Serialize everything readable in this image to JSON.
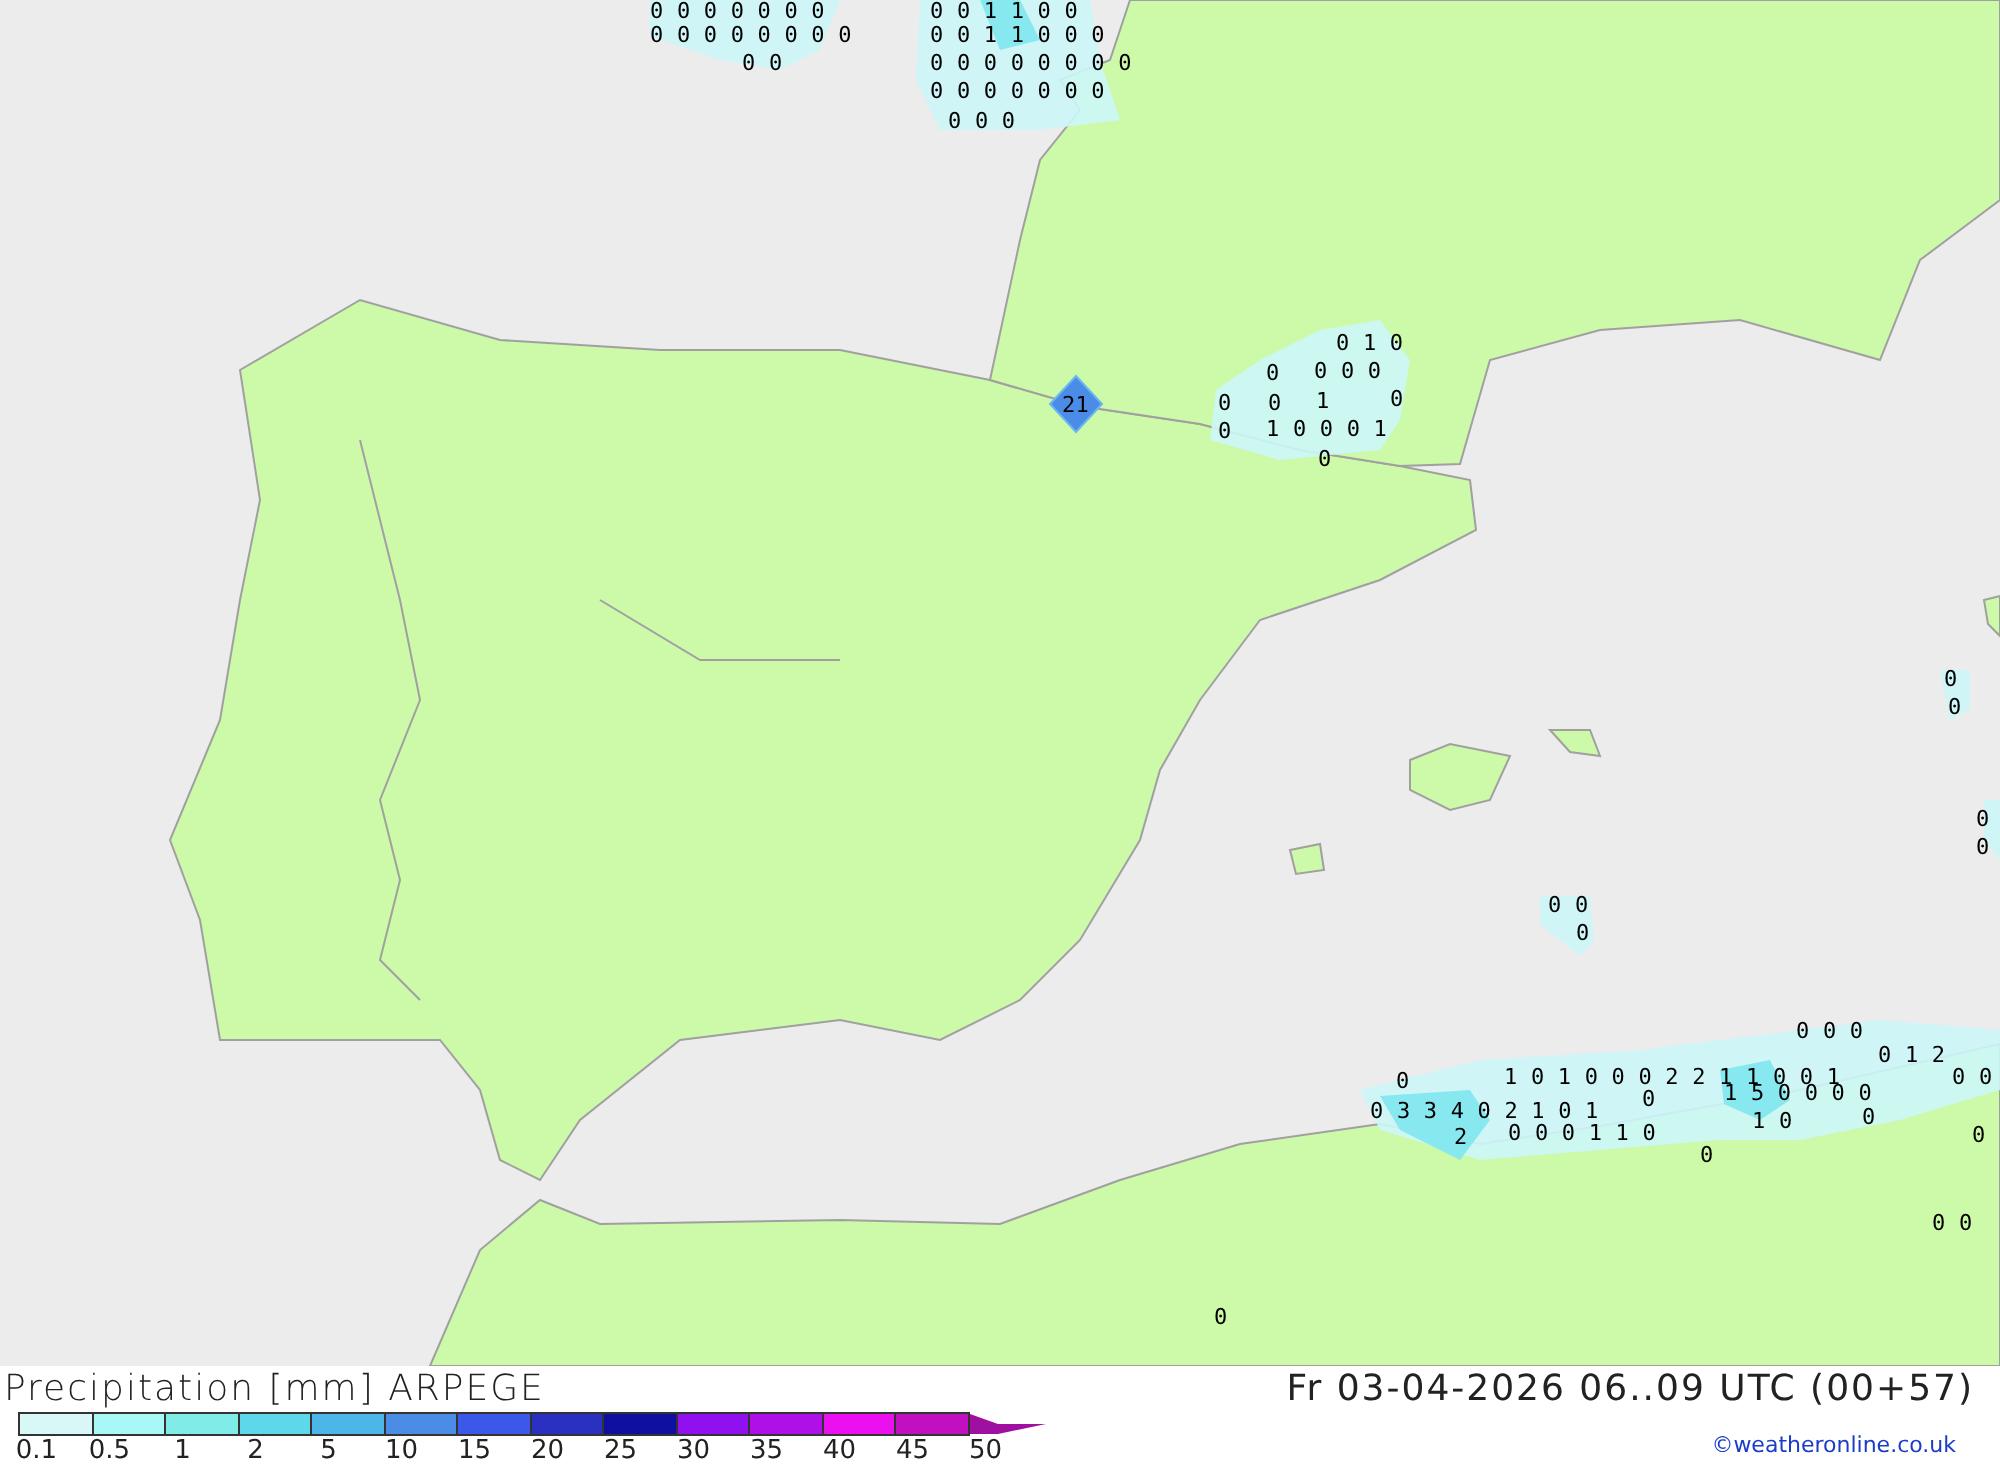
{
  "map": {
    "labels": [
      "0 0 0 0 0 0 0",
      "0 0 0 0 0 0 0 0",
      "0 0",
      "0 0 1 1 0 0",
      "0 0 1 1 0 0 0",
      "0 0 0 0 0 0 0 0",
      "0 0 0 0 0 0 0",
      "0 0 0",
      "0 1 0",
      "0",
      "0 0 0",
      "0",
      "0",
      "1",
      "0",
      "0",
      "1 0 0 0 1",
      "0",
      "21",
      "0",
      "0",
      "0",
      "0",
      "0 0",
      "0",
      "0 0 0",
      "0",
      "0 1 2",
      "1 0 1 0 0 0 2 2 1 1 0 0 1",
      "0 0",
      "0 3 3 4 0 2 1 0 1",
      "0",
      "1 5 0 0 0 0",
      "2",
      "0 0 0 1 1 0",
      "1 0",
      "0",
      "0",
      "0",
      "0 0",
      "0"
    ]
  },
  "title": "Precipitation [mm] ARPEGE",
  "datetime": "Fr 03-04-2026 06..09 UTC (00+57)",
  "legend": [
    {
      "color": "#d8f8f8"
    },
    {
      "color": "#a8f8f8"
    },
    {
      "color": "#80ece8"
    },
    {
      "color": "#5cd8ea"
    },
    {
      "color": "#4cb6ea"
    },
    {
      "color": "#4a8ce6"
    },
    {
      "color": "#3c58e8"
    },
    {
      "color": "#2a30c0"
    },
    {
      "color": "#1010a0"
    },
    {
      "color": "#9010f0"
    },
    {
      "color": "#b010e8"
    },
    {
      "color": "#ea10f0"
    },
    {
      "color": "#c010c0"
    }
  ],
  "legend_labels": [
    "0.1",
    "0.5",
    "1",
    "2",
    "5",
    "10",
    "15",
    "20",
    "25",
    "30",
    "35",
    "40",
    "45",
    "50"
  ],
  "credit": "©weatheronline.co.uk"
}
